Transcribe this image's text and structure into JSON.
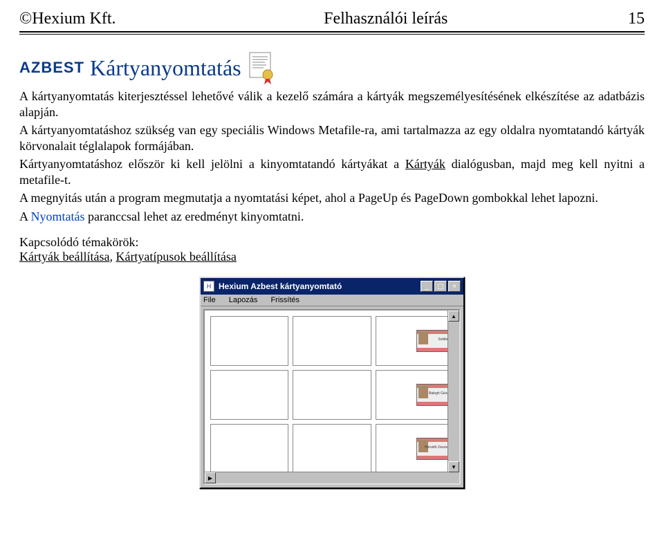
{
  "header": {
    "left": "©Hexium Kft.",
    "center": "Felhasználói leírás",
    "page_number": "15"
  },
  "title": {
    "brand": "AZBEST",
    "text": "Kártyanyomtatás"
  },
  "paragraphs": {
    "p1": "A kártyanyomtatás kiterjesztéssel lehetővé válik a kezelő számára a kártyák megszemélyesítésének elkészítése az adatbázis alapján.",
    "p2": "A kártyanyomtatáshoz szükség van egy speciális Windows Metafile-ra, ami tartalmazza az egy oldalra nyomtatandó kártyák körvonalait téglalapok formájában.",
    "p3_a": "Kártyanyomtatáshoz először ki kell jelölni a kinyomtatandó kártyákat a ",
    "p3_link": "Kártyák",
    "p3_b": " dialógusban, majd meg kell nyitni a metafile-t.",
    "p4": "A megnyitás után a program megmutatja a nyomtatási képet, ahol a PageUp és PageDown gombokkal lehet lapozni.",
    "p5_a": "A ",
    "p5_b": "Nyomtatás",
    "p5_c": " paranccsal lehet az eredményt kinyomtatni."
  },
  "related": {
    "heading": "Kapcsolódó témakörök:",
    "link1": "Kártyák beállítása",
    "sep": ", ",
    "link2": "Kártyatípusok beállítása"
  },
  "app": {
    "title": "Hexium Azbest kártyanyomtató",
    "menu": {
      "file": "File",
      "lapozas": "Lapozás",
      "frissites": "Frissítés"
    },
    "buttons": {
      "min": "_",
      "max": "▢",
      "close": "×"
    },
    "scroll": {
      "up": "▲",
      "down": "▼",
      "left": "◀",
      "right": "▶"
    },
    "cards": [
      {
        "has_card": false
      },
      {
        "has_card": false
      },
      {
        "has_card": true,
        "name": "Soldier"
      },
      {
        "has_card": false
      },
      {
        "has_card": false
      },
      {
        "has_card": true,
        "name": "Balogh Géza"
      },
      {
        "has_card": false
      },
      {
        "has_card": false
      },
      {
        "has_card": true,
        "name": "Horváth Zsuzsa"
      }
    ]
  }
}
